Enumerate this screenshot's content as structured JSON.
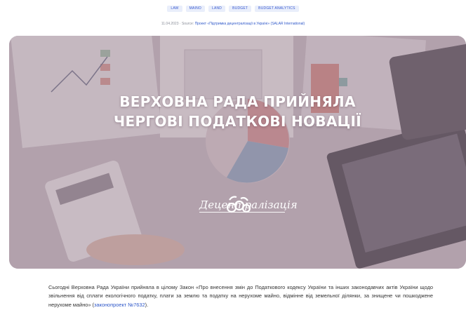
{
  "tags": [
    "LAW",
    "MAINO",
    "LAND",
    "BUDGET",
    "BUDGET ANALYTICS"
  ],
  "meta": {
    "date": "11.04.2023",
    "separator": "·",
    "source_label": "Source:",
    "source_link": "Проект «Підтримка децентралізації в Україні» (SALAR International)"
  },
  "hero": {
    "title_line1": "ВЕРХОВНА РАДА ПРИЙНЯЛА",
    "title_line2": "ЧЕРГОВІ ПОДАТКОВІ НОВАЦІЇ",
    "logo_text": "Децентралізація"
  },
  "article": {
    "text": "Сьогодні Верховна Рада України прийняла в цілому Закон «Про внесення змін до Податкового кодексу України та інших законодавчих актів України щодо звільнення від сплати екологічного податку, плати за землю та податку на нерухоме майно, відмінне від земельної ділянки, за знищене чи пошкоджене нерухоме майно» (",
    "link": "законопроект №7632",
    "tail": ")."
  },
  "colors": {
    "tag_bg": "#e9eefb",
    "tag_text": "#3a5bd0",
    "link": "#2f58c9",
    "hero_overlay": "#b7a9b3"
  }
}
